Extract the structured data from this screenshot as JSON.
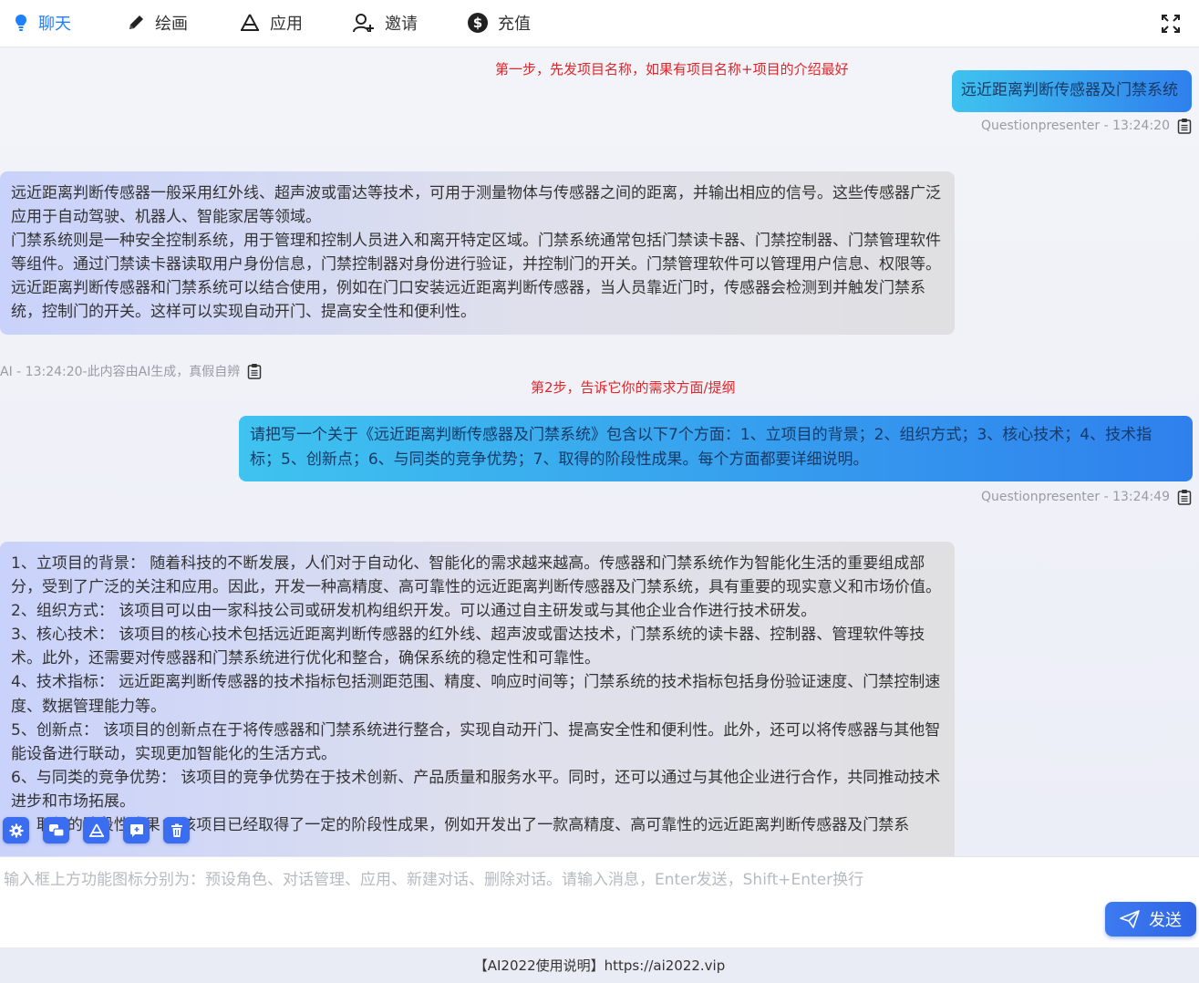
{
  "nav": {
    "items": [
      {
        "label": "聊天",
        "icon": "lightbulb-icon"
      },
      {
        "label": "绘画",
        "icon": "pencil-icon"
      },
      {
        "label": "应用",
        "icon": "apps-icon"
      },
      {
        "label": "邀请",
        "icon": "invite-user-icon"
      },
      {
        "label": "充值",
        "icon": "dollar-icon"
      }
    ],
    "active_color": "#1e80ff"
  },
  "chat": {
    "annotation_1": "第一步，先发项目名称，如果有项目名称+项目的介绍最好",
    "annotation_2": "第2步，告诉它你的需求方面/提纲",
    "messages": [
      {
        "role": "user",
        "text": "远近距离判断传感器及门禁系统",
        "meta": "Questionpresenter - 13:24:20"
      },
      {
        "role": "ai",
        "paragraphs": [
          "远近距离判断传感器一般采用红外线、超声波或雷达等技术，可用于测量物体与传感器之间的距离，并输出相应的信号。这些传感器广泛应用于自动驾驶、机器人、智能家居等领域。",
          "门禁系统则是一种安全控制系统，用于管理和控制人员进入和离开特定区域。门禁系统通常包括门禁读卡器、门禁控制器、门禁管理软件等组件。通过门禁读卡器读取用户身份信息，门禁控制器对身份进行验证，并控制门的开关。门禁管理软件可以管理用户信息、权限等。",
          "远近距离判断传感器和门禁系统可以结合使用，例如在门口安装远近距离判断传感器，当人员靠近门时，传感器会检测到并触发门禁系统，控制门的开关。这样可以实现自动开门、提高安全性和便利性。"
        ],
        "meta": "AI - 13:24:20-此内容由AI生成，真假自辨"
      },
      {
        "role": "user",
        "text": "请把写一个关于《远近距离判断传感器及门禁系统》包含以下7个方面：1、立项目的背景；2、组织方式；3、核心技术；4、技术指标；5、创新点；6、与同类的竞争优势；7、取得的阶段性成果。每个方面都要详细说明。",
        "meta": "Questionpresenter - 13:24:49"
      },
      {
        "role": "ai",
        "paragraphs": [
          "1、立项目的背景： 随着科技的不断发展，人们对于自动化、智能化的需求越来越高。传感器和门禁系统作为智能化生活的重要组成部分，受到了广泛的关注和应用。因此，开发一种高精度、高可靠性的远近距离判断传感器及门禁系统，具有重要的现实意义和市场价值。",
          "2、组织方式： 该项目可以由一家科技公司或研发机构组织开发。可以通过自主研发或与其他企业合作进行技术研发。",
          "3、核心技术： 该项目的核心技术包括远近距离判断传感器的红外线、超声波或雷达技术，门禁系统的读卡器、控制器、管理软件等技术。此外，还需要对传感器和门禁系统进行优化和整合，确保系统的稳定性和可靠性。",
          "4、技术指标： 远近距离判断传感器的技术指标包括测距范围、精度、响应时间等；门禁系统的技术指标包括身份验证速度、门禁控制速度、数据管理能力等。",
          "5、创新点： 该项目的创新点在于将传感器和门禁系统进行整合，实现自动开门、提高安全性和便利性。此外，还可以将传感器与其他智能设备进行联动，实现更加智能化的生活方式。",
          "6、与同类的竞争优势： 该项目的竞争优势在于技术创新、产品质量和服务水平。同时，还可以通过与其他企业进行合作，共同推动技术进步和市场拓展。",
          "7、取得的阶段性成果： 该项目已经取得了一定的阶段性成果，例如开发出了一款高精度、高可靠性的远近距离判断传感器及门禁系"
        ]
      }
    ]
  },
  "tools": [
    {
      "name": "preset-role-button",
      "icon": "gear-icon"
    },
    {
      "name": "conversation-manage-button",
      "icon": "chat-bubbles-icon"
    },
    {
      "name": "apps-button",
      "icon": "apps-icon"
    },
    {
      "name": "new-conversation-button",
      "icon": "new-chat-icon"
    },
    {
      "name": "delete-conversation-button",
      "icon": "trash-icon"
    }
  ],
  "input": {
    "placeholder": "输入框上方功能图标分别为：预设角色、对话管理、应用、新建对话、删除对话。请输入消息，Enter发送，Shift+Enter换行",
    "send_label": "发送"
  },
  "footer": {
    "text": "【AI2022使用说明】https://ai2022.vip"
  }
}
